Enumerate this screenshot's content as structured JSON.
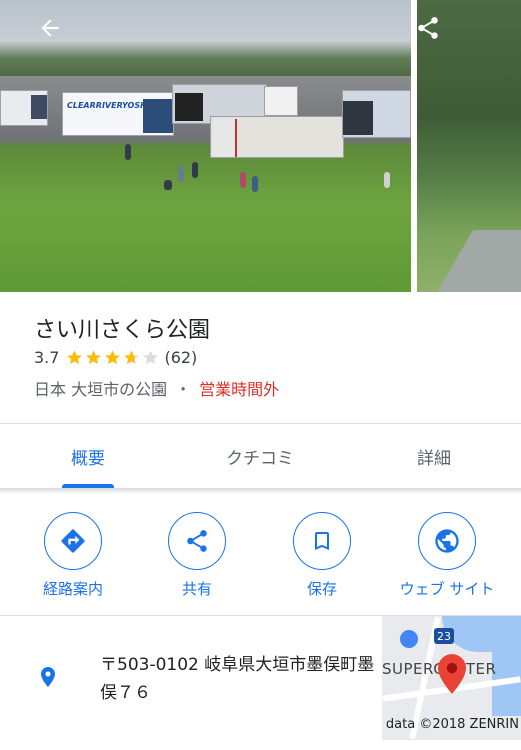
{
  "place": {
    "name": "さい川さくら公園",
    "rating": "3.7",
    "rating_value": 3.7,
    "review_count": "(62)",
    "category": "日本 大垣市の公園",
    "separator": "・",
    "hours_status": "営業時間外"
  },
  "photo": {
    "truck_text": "CLEARRIVERYOSHINO"
  },
  "tabs": [
    {
      "label": "概要",
      "active": true
    },
    {
      "label": "クチコミ",
      "active": false
    },
    {
      "label": "詳細",
      "active": false
    }
  ],
  "actions": [
    {
      "label": "経路案内",
      "icon": "directions-icon"
    },
    {
      "label": "共有",
      "icon": "share-icon"
    },
    {
      "label": "保存",
      "icon": "bookmark-icon"
    },
    {
      "label": "ウェブ サイト",
      "icon": "globe-icon"
    }
  ],
  "address": {
    "text": "〒503-0102 岐阜県大垣市墨俣町墨俣７６"
  },
  "map": {
    "route_number": "23",
    "store_label": "SUPERCENTER",
    "attribution": "data ©2018 ZENRIN"
  },
  "colors": {
    "accent": "#1a73e8",
    "star": "#fbbc04",
    "closed": "#d93025",
    "pin": "#1a73e8",
    "map_marker": "#ea4335"
  }
}
